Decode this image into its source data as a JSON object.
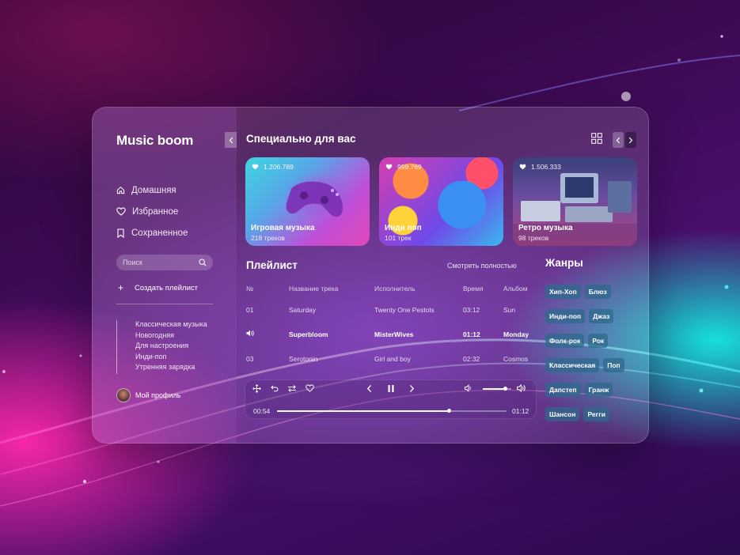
{
  "sidebar": {
    "logo": "Music boom",
    "nav": [
      {
        "label": "Домашняя",
        "icon": "home-icon"
      },
      {
        "label": "Избранное",
        "icon": "heart-icon"
      },
      {
        "label": "Сохраненное",
        "icon": "bookmark-icon"
      }
    ],
    "search_placeholder": "Поиск",
    "create_label": "Создать плейлист",
    "playlists": [
      "Классическая музыка",
      "Новогодняя",
      "Для настроения",
      "Инди-поп",
      "Утренняя зарядка"
    ],
    "profile_label": "Мой профиль"
  },
  "featured": {
    "title": "Специально для вас",
    "cards": [
      {
        "likes": "1.206.789",
        "title": "Игровая музыка",
        "subtitle": "218 треков"
      },
      {
        "likes": "999.769",
        "title": "Инди поп",
        "subtitle": "101 трек"
      },
      {
        "likes": "1.506.333",
        "title": "Ретро музыка",
        "subtitle": "98 треков"
      }
    ]
  },
  "playlist": {
    "title": "Плейлист",
    "see_all": "Смотреть полностью",
    "columns": [
      "№",
      "Название трека",
      "Исполнитель",
      "Время",
      "Альбом"
    ],
    "rows": [
      {
        "n": "01",
        "track": "Saturday",
        "artist": "Twenty One Pestols",
        "time": "03:12",
        "album": "Sun",
        "active": false
      },
      {
        "n": "",
        "track": "Superbloom",
        "artist": "MisterWives",
        "time": "01:12",
        "album": "Monday",
        "active": true
      },
      {
        "n": "03",
        "track": "Serotonin",
        "artist": "Girl and boy",
        "time": "02:32",
        "album": "Cosmos",
        "active": false
      }
    ]
  },
  "player": {
    "elapsed": "00:54",
    "duration": "01:12",
    "progress": 0.75,
    "volume": 0.8
  },
  "genres": {
    "title": "Жанры",
    "rows": [
      [
        "Хип-Хоп",
        "Блюз"
      ],
      [
        "Инди-поп",
        "Джаз"
      ],
      [
        "Фолк-рок",
        "Рок"
      ],
      [
        "Классическая",
        "Поп"
      ],
      [
        "Дапстеп",
        "Гранж"
      ],
      [
        "Шансон",
        "Регги"
      ]
    ]
  },
  "colors": {
    "chip": "#2d698c",
    "accent_pink": "#ff28aa",
    "accent_cyan": "#14ebe1"
  }
}
